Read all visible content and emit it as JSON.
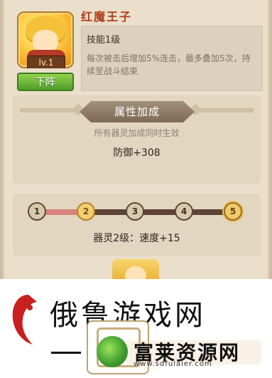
{
  "hero": {
    "name": "红魔王子",
    "level": "lv.1",
    "down_button": "下阵"
  },
  "skill": {
    "title": "技能1级",
    "description": "每次被击后增加5%连击，最多叠加5次，持续至战斗结束"
  },
  "attributes": {
    "banner": "属性加成",
    "subtitle": "所有器灵加成同时生效",
    "value": "防御+308"
  },
  "progress": {
    "nodes": [
      "1",
      "2",
      "3",
      "4",
      "5"
    ],
    "current_level_index": 2,
    "filled_fraction": 0.25,
    "label": "器灵2级：速度+15"
  },
  "watermark": {
    "left_text": "俄鲁游戏网",
    "brand_title": "富莱资源网",
    "brand_url": "www.sdfulaier.com"
  },
  "colors": {
    "name_red": "#b03e1c",
    "button_green": "#4f9d2a",
    "track_fill": "#d8837d"
  }
}
